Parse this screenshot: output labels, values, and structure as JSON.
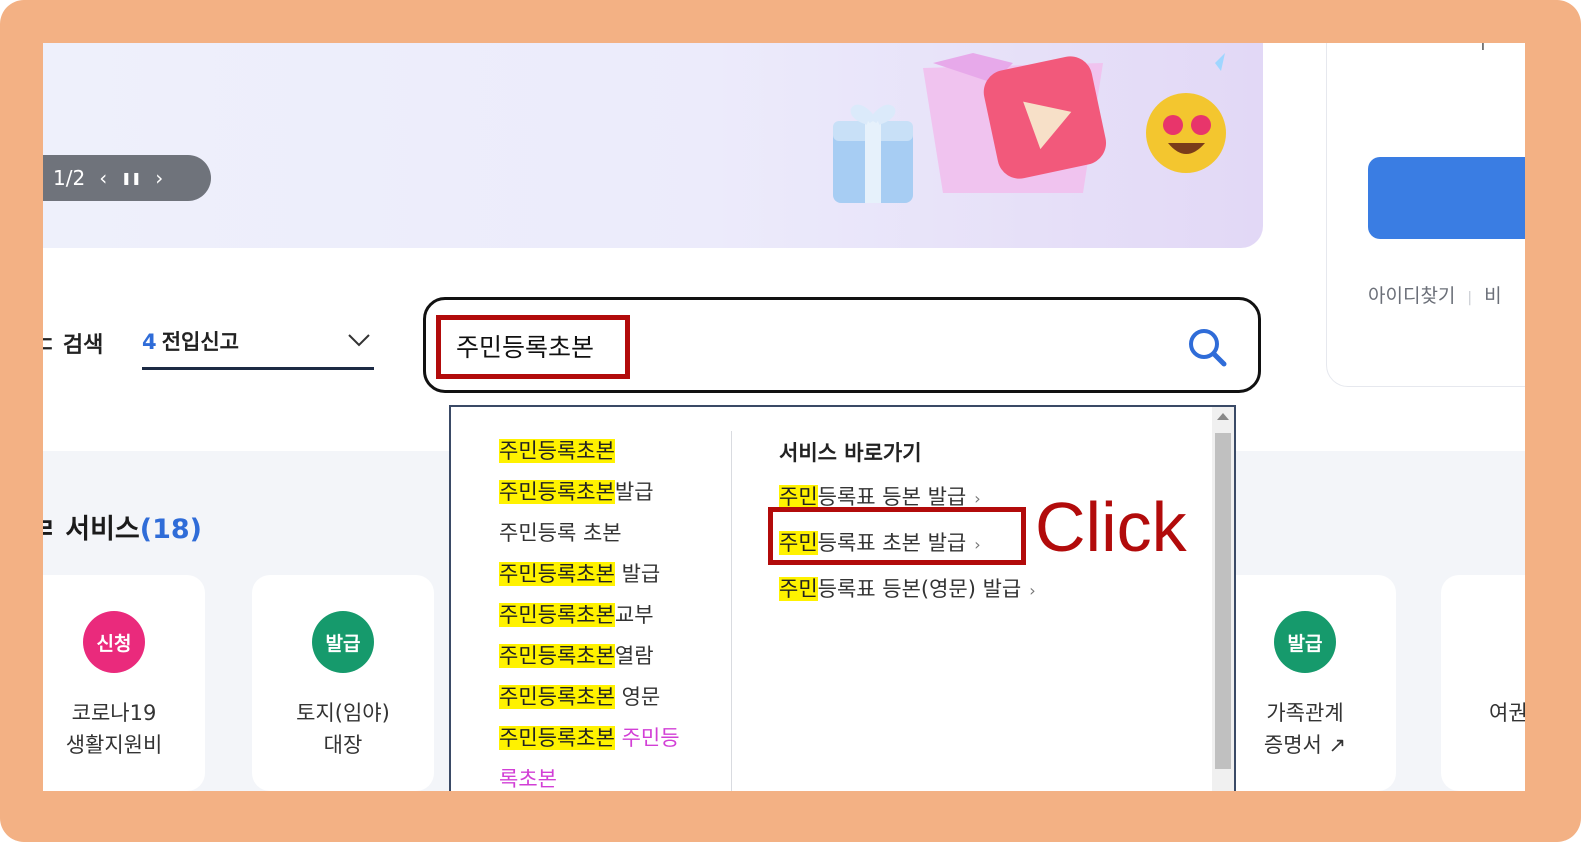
{
  "banner": {
    "slide_counter": "1/2",
    "prev_icon": "‹",
    "pause_icon": "❚❚",
    "next_icon": "›"
  },
  "login": {
    "top_char": "ı",
    "links": [
      "아이디찾기",
      "비"
    ]
  },
  "search": {
    "label": "ㄷ 검색",
    "select_number": "4",
    "select_text": "전입신고",
    "input_value": "주민등록초본",
    "button_icon": "search-icon"
  },
  "autocomplete": {
    "suggestions": [
      {
        "highlight": "주민등록초본",
        "rest": "",
        "pink": ""
      },
      {
        "highlight": "주민등록초본",
        "rest": "발급",
        "pink": ""
      },
      {
        "highlight": "",
        "rest": "주민등록 초본",
        "pink": ""
      },
      {
        "highlight": "주민등록초본",
        "rest": " 발급",
        "pink": ""
      },
      {
        "highlight": "주민등록초본",
        "rest": "교부",
        "pink": ""
      },
      {
        "highlight": "주민등록초본",
        "rest": "열람",
        "pink": ""
      },
      {
        "highlight": "주민등록초본",
        "rest": " 영문",
        "pink": ""
      },
      {
        "highlight": "주민등록초본",
        "rest": " ",
        "pink": "주민등"
      },
      {
        "highlight": "",
        "rest": "",
        "pink": "록초본"
      }
    ],
    "shortcut_title": "서비스 바로가기",
    "shortcuts": [
      {
        "highlight": "주민",
        "rest": "등록표 등본 발급"
      },
      {
        "highlight": "주민",
        "rest": "등록표 초본 발급"
      },
      {
        "highlight": "주민",
        "rest": "등록표 등본(영문) 발급"
      }
    ],
    "arrow": "›"
  },
  "services": {
    "title": "ㄹ 서비스",
    "count": "(18)",
    "cards": [
      {
        "badge": "신청",
        "color": "#ea2a7c",
        "line1": "코로나19",
        "line2": "생활지원비"
      },
      {
        "badge": "발급",
        "color": "#169a6c",
        "line1": "토지(임야)",
        "line2": "대장"
      },
      {
        "badge": "발급",
        "color": "#169a6c",
        "line1": "가족관계",
        "line2": "증명서 ↗"
      },
      {
        "badge": "",
        "color": "#ea2a7c",
        "line1": "여권",
        "line2": ""
      }
    ]
  },
  "annotation": {
    "click_label": "Click",
    "highlight_color": "#b20b0b"
  }
}
